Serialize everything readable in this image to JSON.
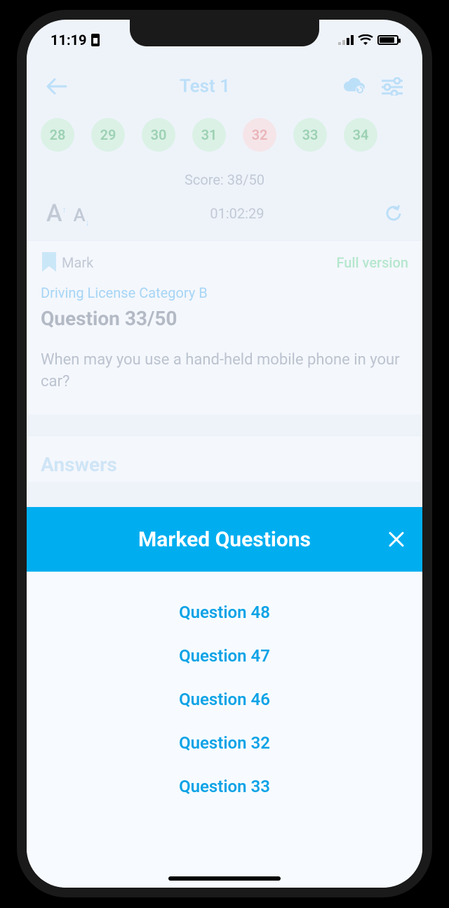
{
  "status": {
    "time": "11:19"
  },
  "header": {
    "title": "Test 1"
  },
  "question_chips": [
    {
      "n": "28",
      "state": "green"
    },
    {
      "n": "29",
      "state": "green"
    },
    {
      "n": "30",
      "state": "green"
    },
    {
      "n": "31",
      "state": "green"
    },
    {
      "n": "32",
      "state": "red"
    },
    {
      "n": "33",
      "state": "green"
    },
    {
      "n": "34",
      "state": "green"
    }
  ],
  "score_text": "Score: 38/50",
  "timer": "01:02:29",
  "mark_label": "Mark",
  "full_version_label": "Full version",
  "category": "Driving License Category B",
  "question_counter": "Question 33/50",
  "question_text": "When may you use a hand-held mobile phone in your car?",
  "answers_heading": "Answers",
  "sheet": {
    "title": "Marked Questions",
    "items": [
      "Question 48",
      "Question 47",
      "Question 46",
      "Question 32",
      "Question 33"
    ]
  }
}
